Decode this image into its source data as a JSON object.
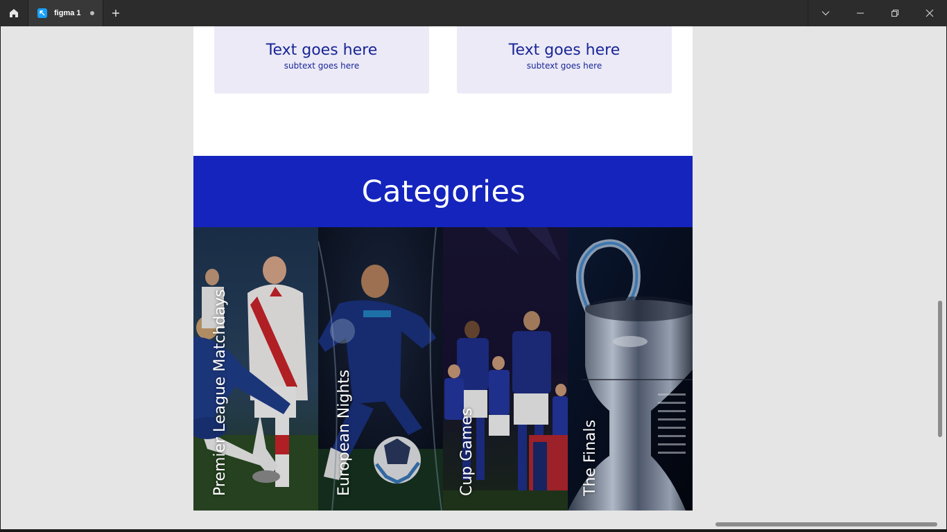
{
  "titlebar": {
    "tab_title": "figma 1",
    "icons": [
      "home-icon",
      "figma-file-icon",
      "unsaved-dot-icon",
      "plus-icon",
      "chevron-down-icon",
      "minimize-icon",
      "restore-icon",
      "close-icon"
    ]
  },
  "cards": [
    {
      "title": "Text goes here",
      "subtitle": "subtext goes here"
    },
    {
      "title": "Text goes here",
      "subtitle": "subtext goes here"
    }
  ],
  "categories": {
    "heading": "Categories",
    "panels": [
      {
        "label": "Premier League Matchdays"
      },
      {
        "label": "European Nights"
      },
      {
        "label": "Cup Games"
      },
      {
        "label": "The Finals"
      }
    ]
  },
  "colors": {
    "accent_blue": "#1424bc",
    "card_bg": "#ebeaf6",
    "card_text": "#1a2597",
    "titlebar_bg": "#2c2c2c"
  }
}
